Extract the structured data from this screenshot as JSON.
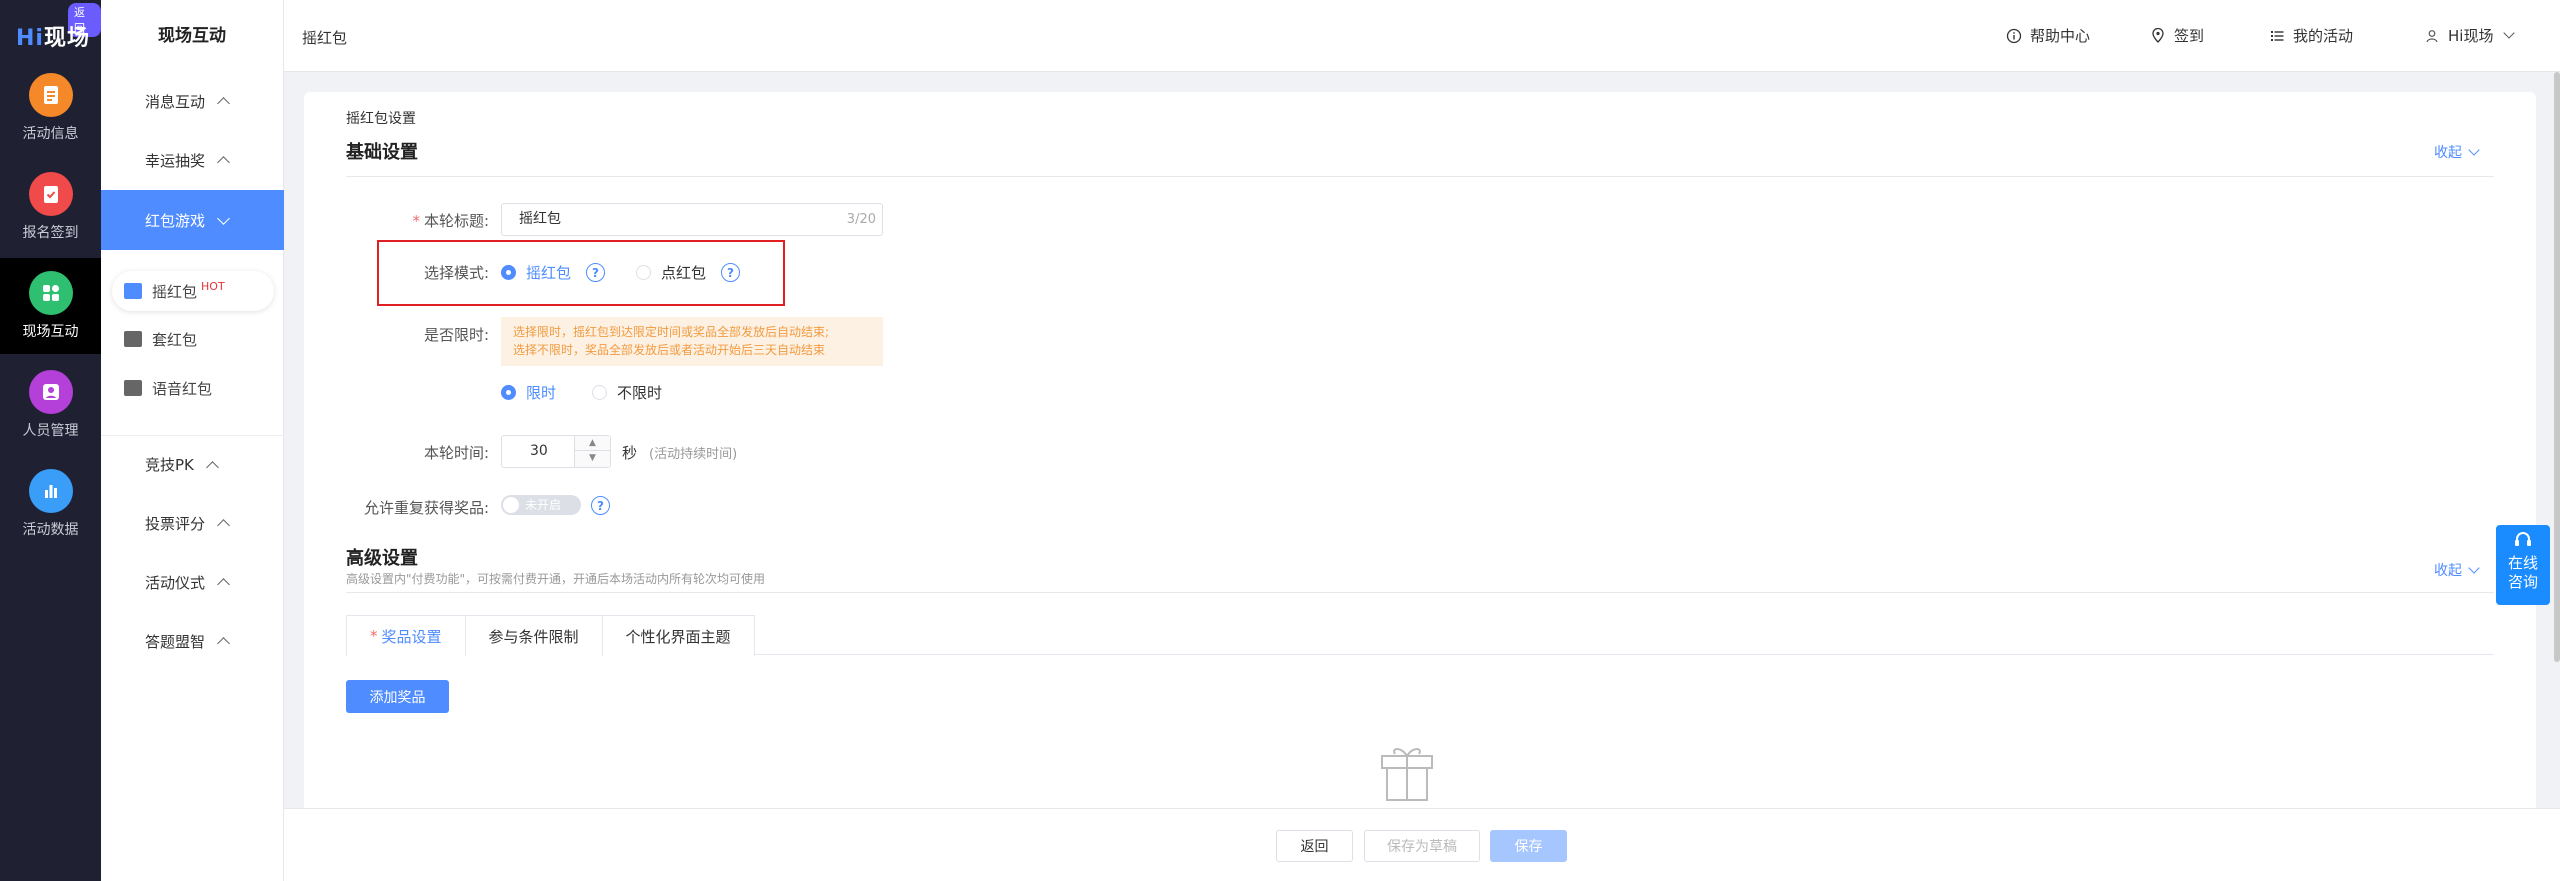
{
  "logo": {
    "text_hi": "Hi",
    "text_rest": "现场",
    "back_badge": "返回"
  },
  "rail": [
    {
      "label": "活动信息",
      "icon": "document-icon",
      "color": "#f5892a"
    },
    {
      "label": "报名签到",
      "icon": "clipboard-check-icon",
      "color": "#f04a4a"
    },
    {
      "label": "现场互动",
      "icon": "interaction-icon",
      "color": "#2fbf71",
      "active": true
    },
    {
      "label": "人员管理",
      "icon": "person-card-icon",
      "color": "#b43fd9"
    },
    {
      "label": "活动数据",
      "icon": "bar-chart-icon",
      "color": "#3a9df7"
    }
  ],
  "sidebar": {
    "title": "现场互动",
    "groups": [
      "消息互动",
      "幸运抽奖",
      "红包游戏",
      "竞技PK",
      "投票评分",
      "活动仪式",
      "答题盟智"
    ],
    "sub_items": [
      "摇红包",
      "套红包",
      "语音红包"
    ],
    "hot": "HOT"
  },
  "header": {
    "breadcrumb": "摇红包",
    "nav": [
      "帮助中心",
      "签到",
      "我的活动",
      "Hi现场"
    ]
  },
  "basic": {
    "small_title": "摇红包设置",
    "title": "基础设置",
    "collapse": "收起",
    "round_title_label": "本轮标题:",
    "round_title_value": "摇红包",
    "round_title_count": "3/20",
    "mode_label": "选择模式:",
    "mode_options": [
      "摇红包",
      "点红包"
    ],
    "limit_label": "是否限时:",
    "limit_tip_1": "选择限时，摇红包到达限定时间或奖品全部发放后自动结束;",
    "limit_tip_2": "选择不限时，奖品全部发放后或者活动开始后三天自动结束",
    "limit_options": [
      "限时",
      "不限时"
    ],
    "time_label": "本轮时间:",
    "time_value": "30",
    "time_unit": "秒",
    "time_hint": "(活动持续时间)",
    "repeat_label": "允许重复获得奖品:",
    "repeat_toggle": "未开启"
  },
  "advanced": {
    "title": "高级设置",
    "subtitle": "高级设置内\"付费功能\"，可按需付费开通，开通后本场活动内所有轮次均可使用",
    "collapse": "收起",
    "tabs": [
      "奖品设置",
      "参与条件限制",
      "个性化界面主题"
    ],
    "add_prize": "添加奖品"
  },
  "footer": {
    "back": "返回",
    "save_draft": "保存为草稿",
    "save": "保存"
  },
  "float_help": {
    "line1": "在线",
    "line2": "咨询"
  },
  "colors": {
    "accent": "#4e8cff",
    "rail_bg": "#1f2133",
    "highlight_box": "#e02020"
  }
}
